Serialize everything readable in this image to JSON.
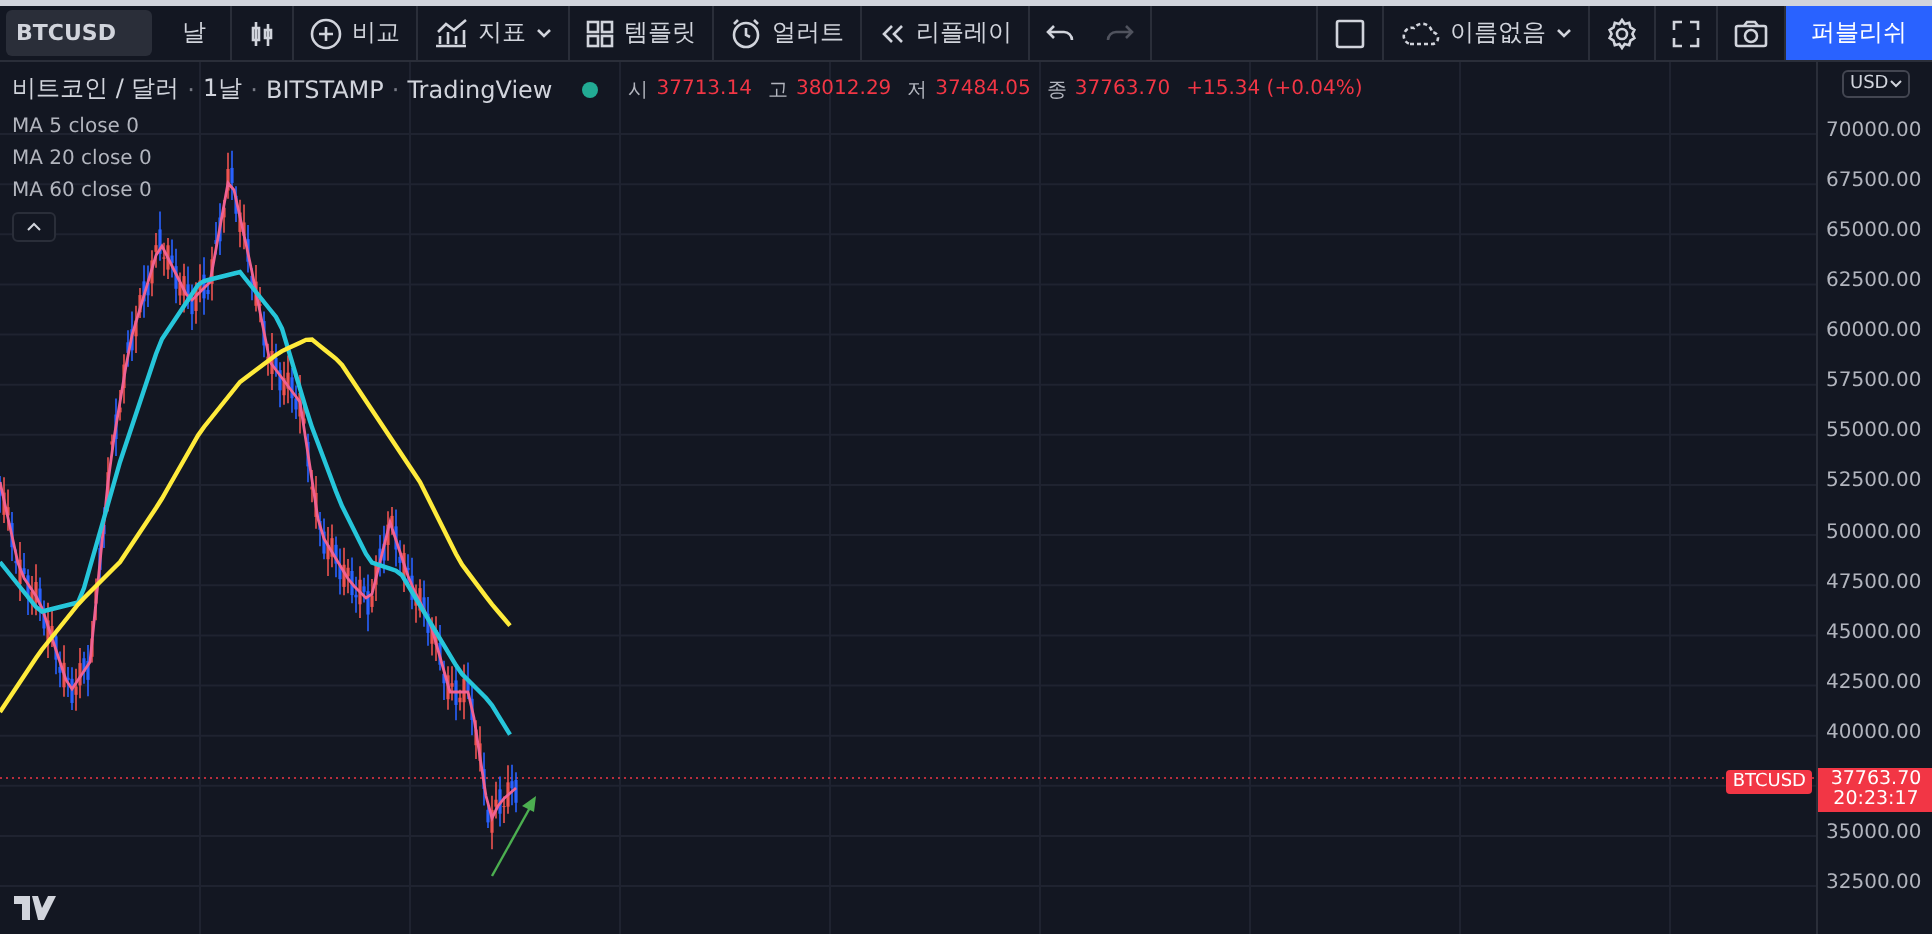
{
  "toolbar": {
    "symbol": "BTCUSD",
    "interval": "날",
    "compare": "비교",
    "indicators": "지표",
    "templates": "템플릿",
    "alerts": "얼러트",
    "replay": "리플레이",
    "undo": {
      "disabled": false
    },
    "redo": {
      "disabled": true
    },
    "layout_name": "이름없음",
    "publish": "퍼블리쉬"
  },
  "legend": {
    "title_parts": [
      "비트코인 / 달러",
      "1날",
      "BITSTAMP",
      "TradingView"
    ],
    "separator": "·",
    "ohlc": [
      {
        "label": "시",
        "value": "37713.14"
      },
      {
        "label": "고",
        "value": "38012.29"
      },
      {
        "label": "저",
        "value": "37484.05"
      },
      {
        "label": "종",
        "value": "37763.70"
      }
    ],
    "change": "+15.34 (+0.04%)",
    "indicators": [
      "MA 5 close 0",
      "MA 20 close 0",
      "MA 60 close 0"
    ]
  },
  "price_axis": {
    "currency": "USD",
    "ticks": [
      "70000.00",
      "67500.00",
      "65000.00",
      "62500.00",
      "60000.00",
      "57500.00",
      "55000.00",
      "52500.00",
      "50000.00",
      "47500.00",
      "45000.00",
      "42500.00",
      "40000.00",
      "35000.00",
      "32500.00"
    ],
    "last_price": "37763.70",
    "countdown": "20:23:17",
    "symbol_tag": "BTCUSD"
  }
}
